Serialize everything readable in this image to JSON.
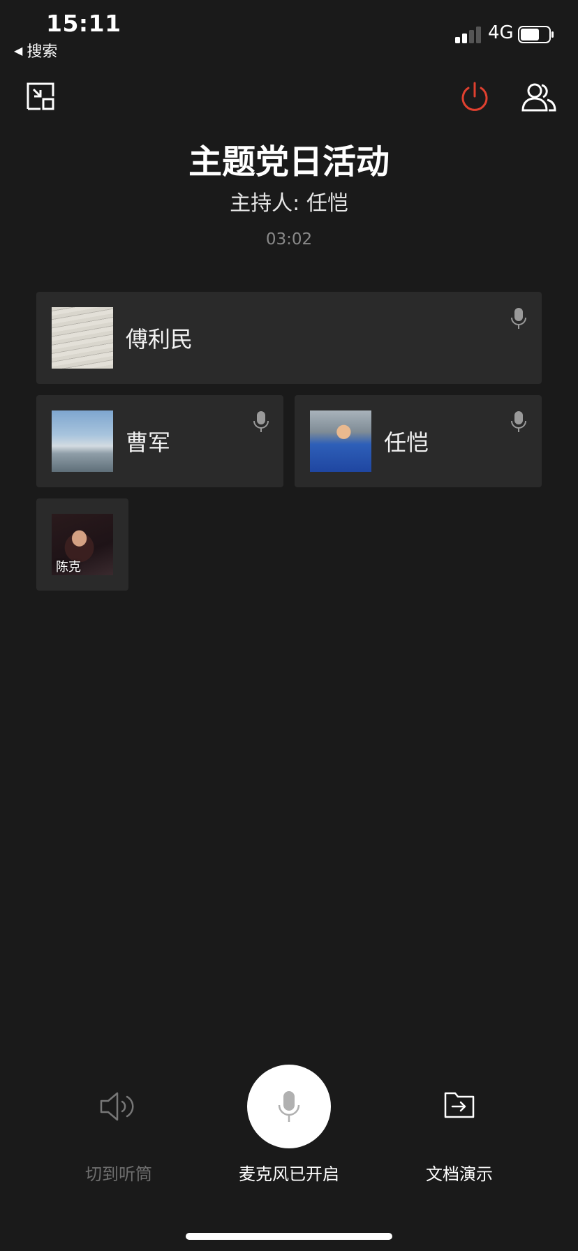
{
  "status_bar": {
    "time": "15:11",
    "back_app": "搜索",
    "network": "4G"
  },
  "meeting": {
    "title": "主题党日活动",
    "host_label": "主持人:",
    "host_name": "任恺",
    "elapsed": "03:02"
  },
  "participants": [
    {
      "name": "傅利民",
      "avatar": "sheet-music-photo"
    },
    {
      "name": "曹军",
      "avatar": "sky-landscape-photo"
    },
    {
      "name": "任恺",
      "avatar": "crowd-photo"
    },
    {
      "name": "陈克",
      "avatar": "portrait-photo"
    }
  ],
  "controls": {
    "speaker_label": "切到听筒",
    "mic_label": "麦克风已开启",
    "doc_label": "文档演示"
  },
  "colors": {
    "background": "#1a1a1a",
    "tile": "#2a2a2a",
    "power_accent": "#e0402f",
    "muted_text": "#6e6e6e"
  }
}
